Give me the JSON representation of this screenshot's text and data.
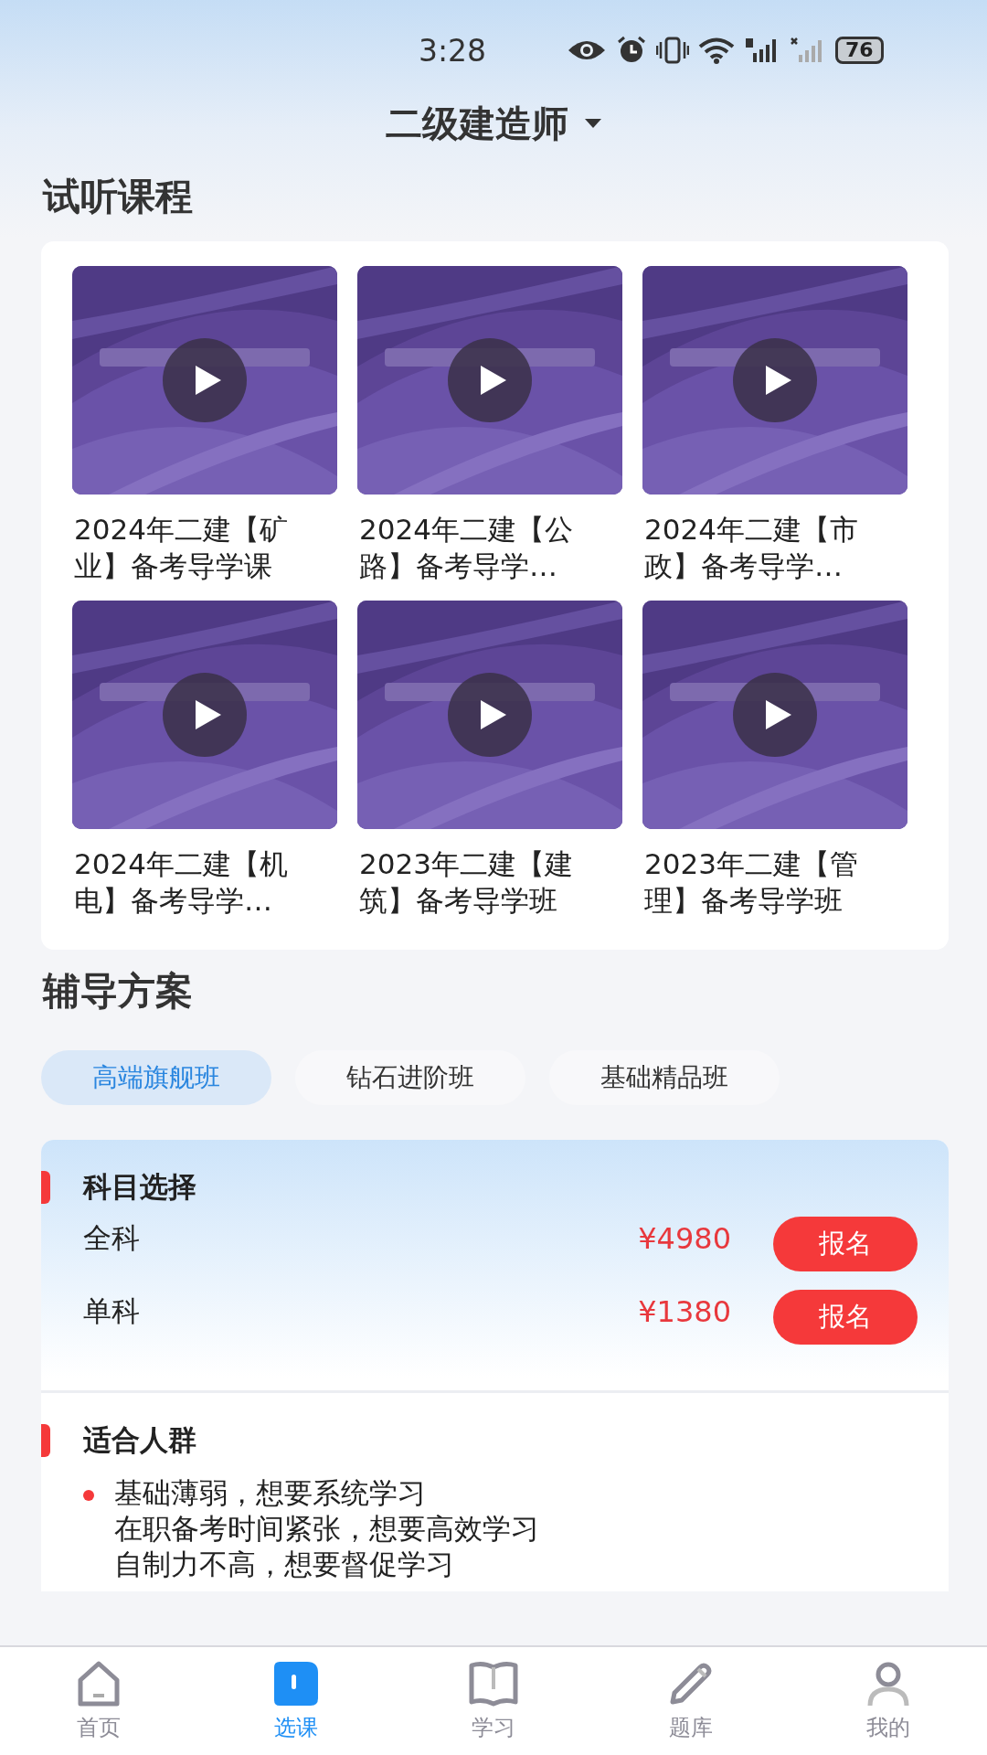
{
  "status_bar": {
    "time": "3:28",
    "battery": "76"
  },
  "header": {
    "title": "二级建造师"
  },
  "trial_section": {
    "title": "试听课程",
    "courses": [
      {
        "title": "2024年二建【矿业】备考导学课"
      },
      {
        "title": "2024年二建【公路】备考导学…"
      },
      {
        "title": "2024年二建【市政】备考导学…"
      },
      {
        "title": "2024年二建【机电】备考导学…"
      },
      {
        "title": "2023年二建【建筑】备考导学班"
      },
      {
        "title": "2023年二建【管理】备考导学班"
      }
    ]
  },
  "plan_section": {
    "title": "辅导方案",
    "tabs": [
      {
        "label": "高端旗舰班",
        "selected": true
      },
      {
        "label": "钻石进阶班",
        "selected": false
      },
      {
        "label": "基础精品班",
        "selected": false
      }
    ],
    "subject_title": "科目选择",
    "options": [
      {
        "name": "全科",
        "price": "¥4980",
        "button": "报名"
      },
      {
        "name": "单科",
        "price": "¥1380",
        "button": "报名"
      }
    ],
    "audience_title": "适合人群",
    "audience_lines": [
      "基础薄弱，想要系统学习",
      "在职备考时间紧张，想要高效学习",
      "自制力不高，想要督促学习"
    ]
  },
  "bottom_nav": [
    {
      "label": "首页",
      "kind": "home",
      "selected": false
    },
    {
      "label": "选课",
      "kind": "course",
      "selected": true
    },
    {
      "label": "学习",
      "kind": "book",
      "selected": false
    },
    {
      "label": "题库",
      "kind": "pencil",
      "selected": false
    },
    {
      "label": "我的",
      "kind": "person",
      "selected": false
    }
  ]
}
